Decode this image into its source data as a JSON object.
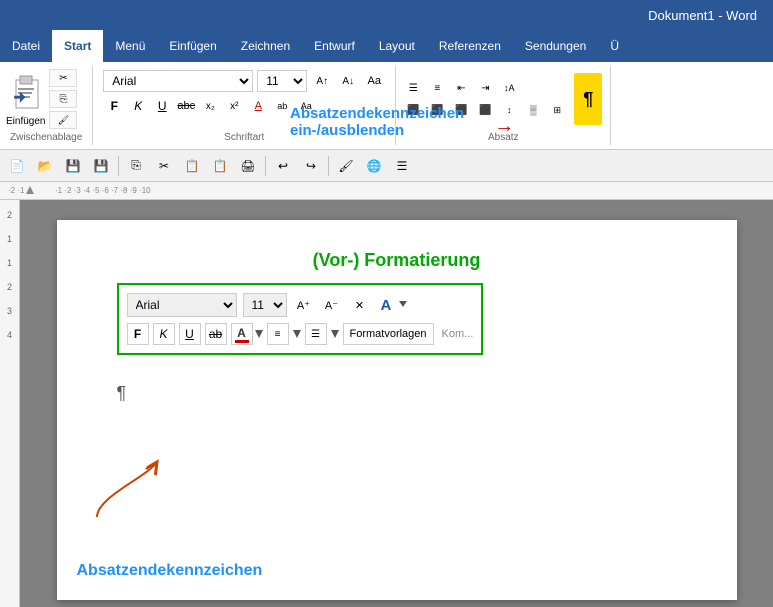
{
  "titlebar": {
    "title": "Dokument1 - Word"
  },
  "tabs": [
    {
      "label": "Datei",
      "active": false
    },
    {
      "label": "Start",
      "active": true
    },
    {
      "label": "Menü",
      "active": false
    },
    {
      "label": "Einfügen",
      "active": false
    },
    {
      "label": "Zeichnen",
      "active": false
    },
    {
      "label": "Entwurf",
      "active": false
    },
    {
      "label": "Layout",
      "active": false
    },
    {
      "label": "Referenzen",
      "active": false
    },
    {
      "label": "Sendungen",
      "active": false
    },
    {
      "label": "Ü",
      "active": false
    }
  ],
  "ribbon": {
    "clipboard": {
      "label": "Zwischenablage",
      "einfuegen": "Einfügen"
    },
    "font": {
      "label": "Schriftart",
      "font_name": "Arial",
      "font_size": "11",
      "bold": "F",
      "italic": "K",
      "underline": "U",
      "strikethrough": "abc",
      "subscript": "x₂",
      "superscript": "x²"
    },
    "paragraph": {
      "label": "Absatz",
      "pilcrow": "¶"
    }
  },
  "tooltip": {
    "line1": "Absatzendekennzeichen",
    "line2": "ein-/ausblenden",
    "arrow_text": "→"
  },
  "document": {
    "annotation_title": "(Vor-) Formatierung",
    "font_name": "Arial",
    "font_size": "11",
    "bold": "F",
    "italic": "K",
    "underline": "U",
    "strikethrough": "ab̶",
    "color_a": "A",
    "formatvorlagen": "Formatvorlagen",
    "kommentare_short": "Kom...",
    "pilcrow": "¶",
    "annotation_bottom": "Absatzendekennzeichen"
  },
  "ruler": {
    "marks": [
      "2",
      "1",
      "1",
      "2",
      "3",
      "4",
      "5",
      "6",
      "7",
      "8",
      "9",
      "10"
    ]
  }
}
